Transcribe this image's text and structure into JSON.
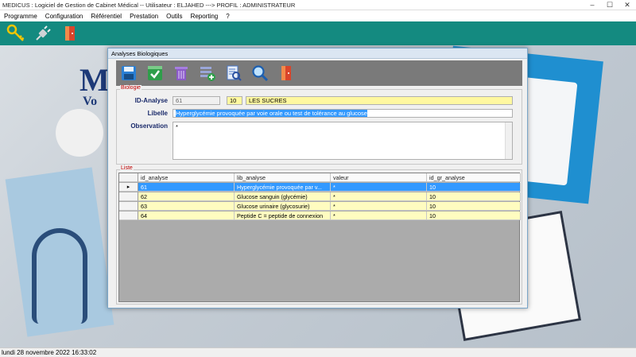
{
  "window": {
    "title": "MEDICUS : Logiciel de Gestion de Cabinet Médical -- Utilisateur : ELJAHED ---> PROFIL : ADMINISTRATEUR"
  },
  "menu": [
    "Programme",
    "Configuration",
    "Référentiel",
    "Prestation",
    "Outils",
    "Reporting",
    "?"
  ],
  "background": {
    "logo_text": "M",
    "logo_sub": "Vo"
  },
  "dialog": {
    "title": "Analyses Biologiques",
    "biologie": {
      "group_label": "Biologie",
      "id_label": "ID-Analyse",
      "id_value": "61",
      "group_id_value": "10",
      "group_name_value": "LES SUCRES",
      "libelle_label": "Libelle",
      "libelle_value": "Hyperglycémie provoquée par voie orale ou test de tolérance au glucose",
      "observation_label": "Observation",
      "observation_value": "*"
    },
    "liste": {
      "group_label": "Liste",
      "columns": [
        "id_analyse",
        "lib_analyse",
        "valeur",
        "id_gr_analyse"
      ],
      "rows": [
        {
          "id_analyse": "61",
          "lib_analyse": "Hyperglycémie provoquée par v...",
          "valeur": "*",
          "id_gr_analyse": "10",
          "selected": true
        },
        {
          "id_analyse": "62",
          "lib_analyse": "Glucose sanguin (glycémie)",
          "valeur": "*",
          "id_gr_analyse": "10"
        },
        {
          "id_analyse": "63",
          "lib_analyse": "Glucose urinaire (glycosurie)",
          "valeur": "*",
          "id_gr_analyse": "10"
        },
        {
          "id_analyse": "64",
          "lib_analyse": "Peptide C = peptide de connexion",
          "valeur": "*",
          "id_gr_analyse": "10"
        }
      ],
      "row_indicator": "▸"
    }
  },
  "statusbar": {
    "datetime": "lundi 28 novembre 2022  16:33:02"
  },
  "colors": {
    "toolbar": "#148a80",
    "selection": "#3399ff",
    "row_yellow": "#fffcc0",
    "label_blue": "#1a2a6a",
    "group_red": "#c00000"
  }
}
